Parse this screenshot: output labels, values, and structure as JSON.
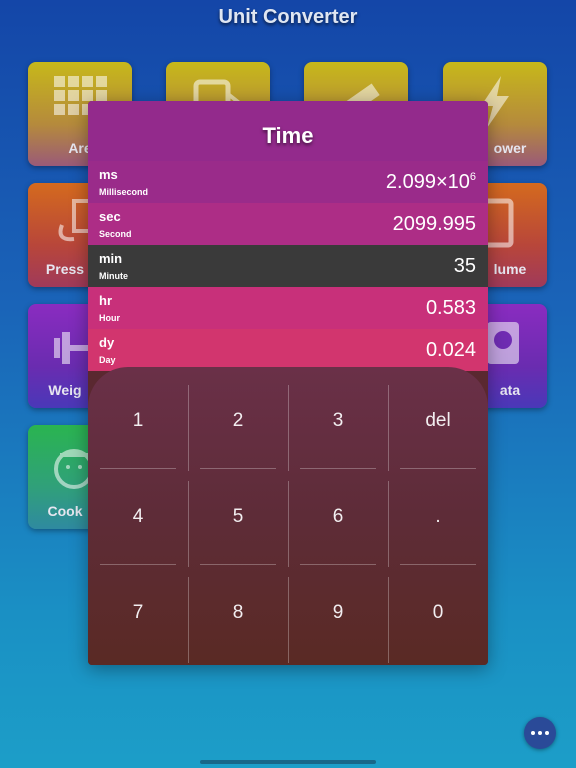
{
  "app": {
    "title": "Unit Converter"
  },
  "tiles": [
    {
      "id": "area",
      "label": "Are",
      "icon": "grid-icon"
    },
    {
      "id": "fuel",
      "label": "",
      "icon": "fuel-icon"
    },
    {
      "id": "length",
      "label": "",
      "icon": "ruler-icon"
    },
    {
      "id": "power",
      "label": "ower",
      "icon": "lightning-icon"
    },
    {
      "id": "pressure",
      "label": "Press",
      "icon": "pressure-gauge-icon"
    },
    {
      "id": "volume",
      "label": "lume",
      "icon": "beaker-icon"
    },
    {
      "id": "weight",
      "label": "Weig",
      "icon": "dumbbell-icon"
    },
    {
      "id": "data",
      "label": "ata",
      "icon": "hard-drive-icon"
    },
    {
      "id": "cooking",
      "label": "Cook",
      "icon": "cooking-pot-icon"
    }
  ],
  "modal": {
    "title": "Time",
    "units": [
      {
        "abbr": "ms",
        "name": "Millisecond",
        "value": "2.099×10",
        "exp": "6",
        "color": "#9a2b8a"
      },
      {
        "abbr": "sec",
        "name": "Second",
        "value": "2099.995",
        "exp": "",
        "color": "#ad2d86"
      },
      {
        "abbr": "min",
        "name": "Minute",
        "value": "35",
        "exp": "",
        "color": "#3a3a3a",
        "selected": true
      },
      {
        "abbr": "hr",
        "name": "Hour",
        "value": "0.583",
        "exp": "",
        "color": "#c8307a"
      },
      {
        "abbr": "dy",
        "name": "Day",
        "value": "0.024",
        "exp": "",
        "color": "#d2356e"
      }
    ]
  },
  "keypad": {
    "keys": [
      [
        "1",
        "2",
        "3",
        "del"
      ],
      [
        "4",
        "5",
        "6",
        "."
      ],
      [
        "7",
        "8",
        "9",
        "0"
      ]
    ]
  },
  "more_button": {
    "icon": "ellipsis-icon"
  }
}
